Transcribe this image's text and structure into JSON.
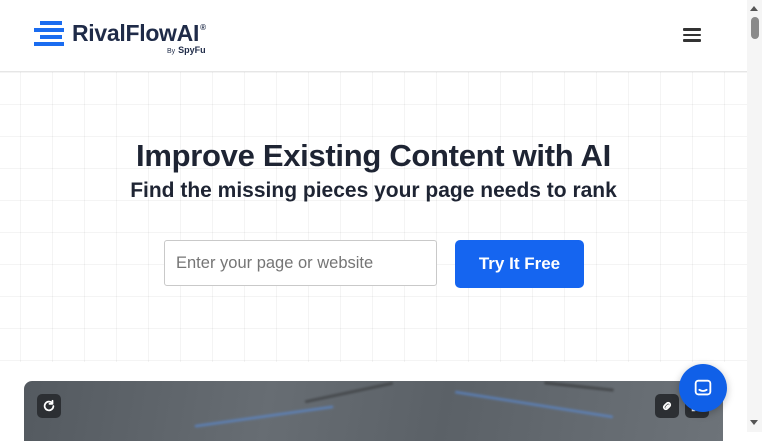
{
  "header": {
    "brand_name": "RivalFlowAI",
    "brand_mark": "®",
    "by_label": "By",
    "by_company": "SpyFu",
    "menu_icon": "hamburger-menu-icon"
  },
  "hero": {
    "title": "Improve Existing Content with AI",
    "subtitle": "Find the missing pieces your page needs to rank",
    "input_placeholder": "Enter your page or website",
    "input_value": "",
    "cta_label": "Try It Free"
  },
  "preview": {
    "refresh_icon": "refresh-icon",
    "link_icon": "link-icon",
    "expand_icon": "expand-icon"
  },
  "chat": {
    "icon": "chat-bubble-icon"
  },
  "colors": {
    "brand_blue": "#1565f0",
    "heading": "#1e2433",
    "logo_text": "#1f2b48",
    "chat_blue": "#1060e8"
  }
}
